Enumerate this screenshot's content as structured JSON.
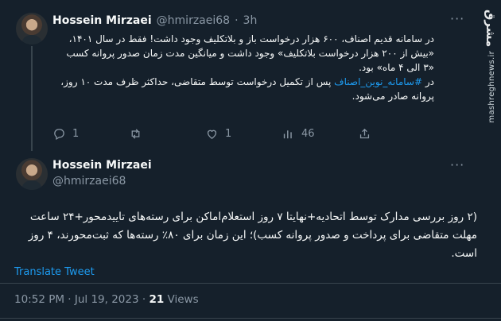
{
  "tweet1": {
    "name": "Hossein Mirzaei",
    "handle": "@hmirzaei68",
    "sep": "·",
    "time": "3h",
    "text_p1": "در سامانه قدیم اصناف، ۶۰۰ هزار درخواست باز و بلاتکلیف وجود داشت! فقط در سال ۱۴۰۱، «بیش از ۲۰۰ هزار درخواست بلاتکلیف» وجود داشت و میانگین مدت زمان صدور پروانه کسب «۳ الی ۴ ماه» بود.",
    "text_p2_prefix": "در ",
    "hashtag": "#سامانه_نوین_اصناف",
    "text_p2_suffix": " پس از تکمیل درخواست توسط متقاضی، حداکثر ظرف مدت ۱۰ روز، پروانه صادر می‌شود.",
    "actions": {
      "reply_count": "1",
      "retweet_count": "",
      "like_count": "1",
      "views_count": "46"
    }
  },
  "tweet2": {
    "name": "Hossein Mirzaei",
    "handle": "@hmirzaei68",
    "text": "(۲ روز بررسی مدارک توسط اتحادیه+نهایتا ۷ روز استعلام‌اماکن برای رسته‌های تاییدمحور+۲۴ ساعت مهلت متقاضی برای پرداخت و صدور پروانه کسب)؛ این زمان برای ۸۰٪ رسته‌ها که ثبت‌محورند، ۴ روز است.",
    "translate": "Translate Tweet",
    "timestamp": "10:52 PM · Jul 19, 2023",
    "meta_sep": "·",
    "views_count": "21",
    "views_label": "Views"
  },
  "watermark": {
    "logo": "مشرق",
    "url": "mashreghnews.ir"
  },
  "colors": {
    "background": "#15202b",
    "text": "#f7f9f9",
    "muted": "#8b98a5",
    "accent": "#1d9bf0",
    "divider": "#38444d"
  },
  "icons": [
    "more-icon",
    "reply-icon",
    "retweet-icon",
    "like-icon",
    "views-icon",
    "share-icon"
  ]
}
